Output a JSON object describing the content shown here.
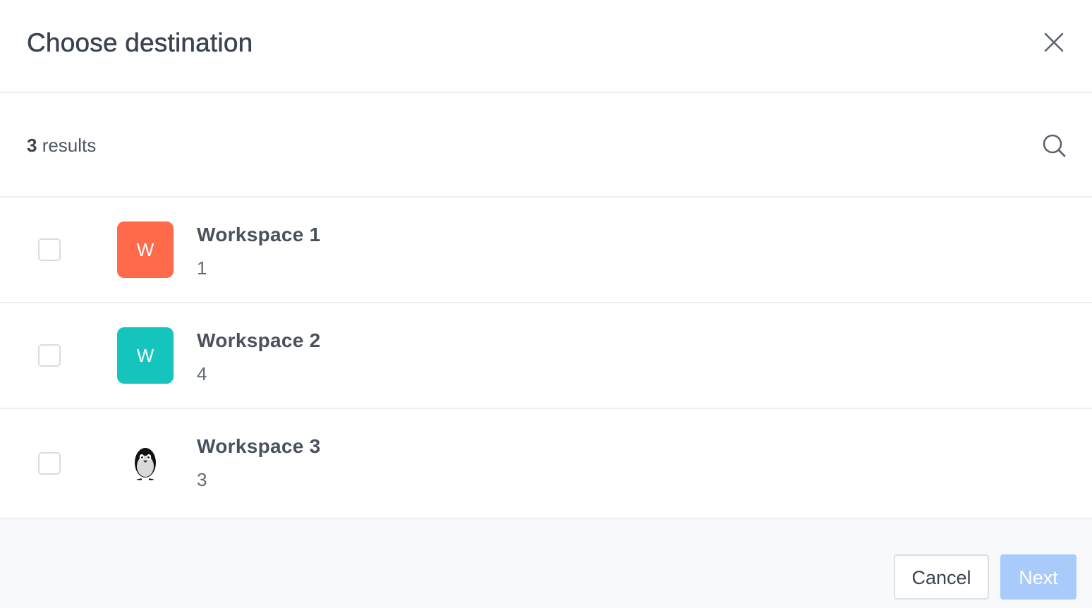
{
  "dialog": {
    "title": "Choose destination"
  },
  "toolbar": {
    "result_count": "3",
    "result_label": " results",
    "search_icon": "search-icon"
  },
  "workspaces": [
    {
      "name": "Workspace 1",
      "sub": "1",
      "avatar_letter": "W",
      "avatar_color": "#ff6a4b",
      "checked": false
    },
    {
      "name": "Workspace 2",
      "sub": "4",
      "avatar_letter": "W",
      "avatar_color": "#14c4bd",
      "checked": false
    },
    {
      "name": "Workspace 3",
      "sub": "3",
      "avatar_letter": "",
      "avatar_icon": "penguin-icon",
      "checked": false
    }
  ],
  "footer": {
    "cancel_label": "Cancel",
    "next_label": "Next"
  },
  "colors": {
    "primary_disabled": "#a9cbfb",
    "footer_bg": "#f8f9fb",
    "divider": "#eceef1"
  }
}
